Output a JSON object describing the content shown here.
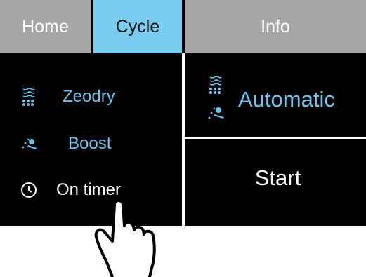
{
  "tabs": [
    {
      "label": "Home",
      "active": false
    },
    {
      "label": "Cycle",
      "active": true
    },
    {
      "label": "Info",
      "active": false
    }
  ],
  "menu": [
    {
      "label": "Zeodry",
      "icon": "zeodry-icon"
    },
    {
      "label": "Boost",
      "icon": "boost-icon"
    },
    {
      "label": "On timer",
      "icon": "clock-icon"
    }
  ],
  "automatic": {
    "label": "Automatic",
    "icons": [
      "zeodry-icon",
      "boost-icon"
    ]
  },
  "start": {
    "label": "Start"
  },
  "colors": {
    "accent": "#79cdf0",
    "tab_bar": "#a6a6a6",
    "screen_background": "#000000",
    "option_text": "#6cc6ee"
  },
  "pointer": "hand-pointer-icon"
}
